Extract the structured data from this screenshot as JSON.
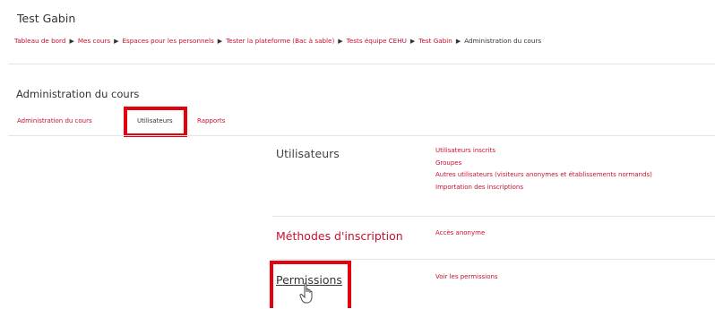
{
  "page": {
    "title": "Test Gabin"
  },
  "breadcrumb": {
    "items": [
      "Tableau de bord",
      "Mes cours",
      "Espaces pour les personnels",
      "Tester la plateforme (Bac à sable)",
      "Tests équipe CEHU",
      "Test Gabin"
    ],
    "current": "Administration du cours",
    "separator": "▶"
  },
  "admin": {
    "heading": "Administration du cours",
    "tabs": [
      {
        "label": "Administration du cours",
        "active": false
      },
      {
        "label": "Utilisateurs",
        "active": true
      },
      {
        "label": "Rapports",
        "active": false
      }
    ]
  },
  "sections": [
    {
      "title": "Utilisateurs",
      "links": [
        "Utilisateurs inscrits",
        "Groupes",
        "Autres utilisateurs (visiteurs anonymes et établissements normands)",
        "Importation des inscriptions"
      ]
    },
    {
      "title": "Méthodes d'inscription",
      "links": [
        "Accès anonyme"
      ]
    },
    {
      "title": "Permissions",
      "links": [
        "Voir les permissions"
      ]
    }
  ],
  "colors": {
    "accent": "#c8102e",
    "highlight": "#e3000f"
  },
  "icons": {
    "pointer": "hand-pointer-icon"
  }
}
